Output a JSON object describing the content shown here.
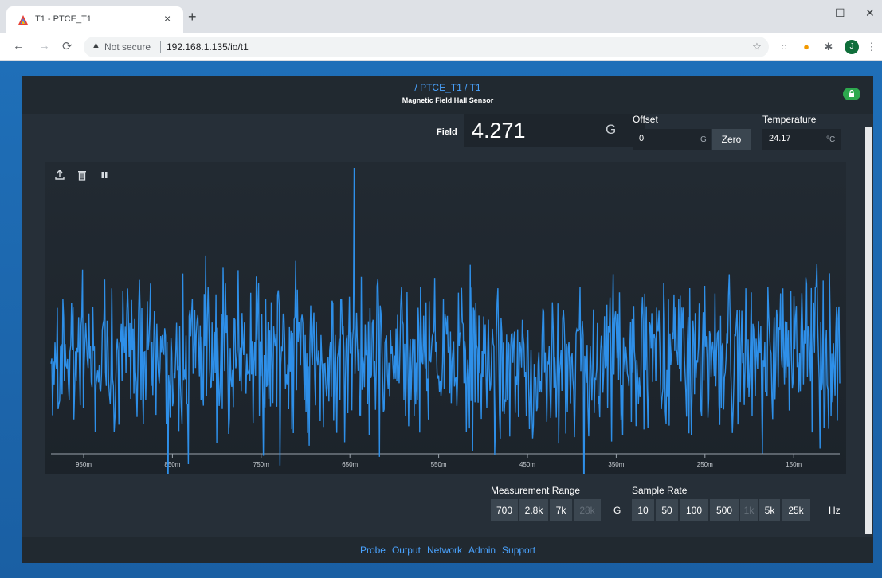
{
  "browser": {
    "tab_title": "T1 - PTCE_T1",
    "tab_close": "×",
    "new_tab": "+",
    "security_label": "Not secure",
    "url": "192.168.1.135/io/t1",
    "avatar_letter": "J",
    "window_minimize": "–",
    "window_maximize": "☐",
    "window_close": "✕"
  },
  "header": {
    "breadcrumb_1": "PTCE_T1",
    "breadcrumb_2": "T1",
    "separator": "/",
    "subtitle": "Magnetic Field Hall Sensor",
    "lock_color": "#2da84e"
  },
  "readout": {
    "field_label": "Field",
    "field_value": "4.271",
    "field_unit": "G",
    "offset_label": "Offset",
    "offset_value": "0",
    "offset_unit": "G",
    "zero_button": "Zero",
    "temperature_label": "Temperature",
    "temperature_value": "24.17",
    "temperature_unit": "°C"
  },
  "chart_data": {
    "type": "line",
    "x_ticks": [
      "950m",
      "850m",
      "750m",
      "650m",
      "550m",
      "450m",
      "350m",
      "250m",
      "150m"
    ],
    "x_range_seconds_ago": [
      1.0,
      0.05
    ],
    "series_color": "#2e8fe8",
    "description_values": "noise trace around field value",
    "y_baseline": 4.271,
    "grid": false
  },
  "controls": {
    "measurement_range_label": "Measurement Range",
    "measurement_range_options": [
      "700",
      "2.8k",
      "7k",
      "28k"
    ],
    "measurement_range_disabled": [
      "28k"
    ],
    "measurement_range_unit": "G",
    "sample_rate_label": "Sample Rate",
    "sample_rate_options": [
      "10",
      "50",
      "100",
      "500",
      "1k",
      "5k",
      "25k"
    ],
    "sample_rate_disabled": [
      "1k"
    ],
    "sample_rate_unit": "Hz"
  },
  "footer": {
    "links": [
      "Probe",
      "Output",
      "Network",
      "Admin",
      "Support"
    ]
  },
  "colors": {
    "accent": "#4aa3ff",
    "panel": "#262f38",
    "page_background": "#1f6fb8"
  }
}
